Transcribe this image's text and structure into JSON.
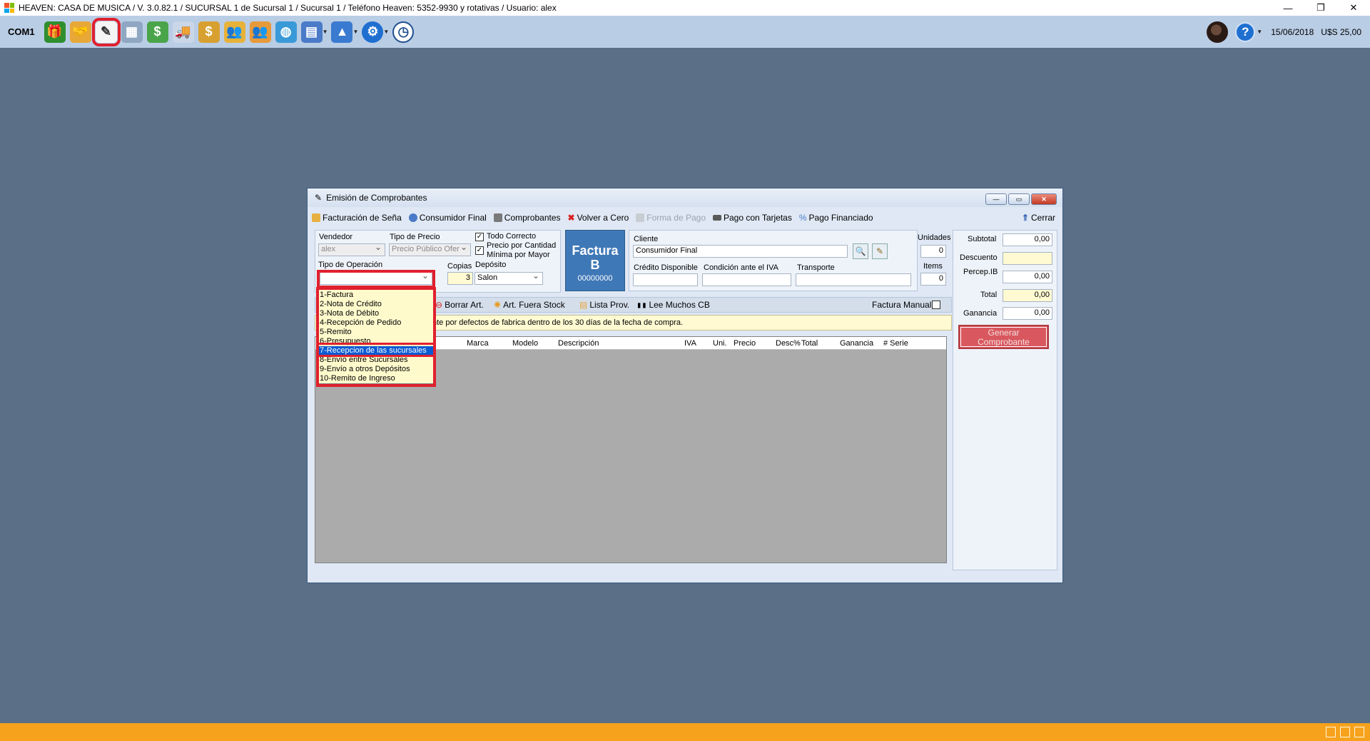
{
  "window": {
    "title": "HEAVEN: CASA DE MUSICA / V. 3.0.82.1 / SUCURSAL 1 de Sucursal 1 / Sucursal 1 / Teléfono Heaven: 5352-9930 y rotativas / Usuario: alex",
    "minimize": "—",
    "restore": "❐",
    "close": "✕"
  },
  "toolbar": {
    "port_label": "COM1",
    "date": "15/06/2018",
    "exchange_rate": "U$S 25,00",
    "help_symbol": "?",
    "icons": [
      "gift-icon",
      "handshake-icon",
      "invoice-icon",
      "calculator-icon",
      "money-icon",
      "delivery-truck-icon",
      "money-bag-icon",
      "users-icon",
      "groups-icon",
      "globe-icon",
      "book-icon",
      "chart-icon",
      "settings-gear-icon",
      "clock-icon"
    ],
    "selected_icon": "invoice-icon"
  },
  "dialog": {
    "title": "Emisión de Comprobantes",
    "menu": {
      "facturacion_sena": "Facturación de Seña",
      "consumidor_final": "Consumidor Final",
      "comprobantes": "Comprobantes",
      "volver_a_cero": "Volver a Cero",
      "forma_de_pago": "Forma de Pago",
      "pago_con_tarjetas": "Pago con Tarjetas",
      "pago_financiado": "Pago Financiado",
      "cerrar": "Cerrar"
    },
    "form": {
      "vendedor_label": "Vendedor",
      "vendedor_value": "alex",
      "tipo_precio_label": "Tipo de Precio",
      "tipo_precio_value": "Precio Público Ofer",
      "todo_correcto_label": "Todo Correcto",
      "todo_correcto_checked": true,
      "precio_cantidad_label": "Precio por Cantidad",
      "minima_mayor_label": "Mínima por Mayor",
      "precio_cantidad_checked": true,
      "tipo_operacion_label": "Tipo de Operación",
      "tipo_operacion_value": "",
      "copias_label": "Copias",
      "copias_value": "3",
      "deposito_label": "Depósito",
      "deposito_value": "Salon"
    },
    "factura": {
      "title_1": "Factura",
      "title_2": "B",
      "number": "00000000"
    },
    "cliente": {
      "cliente_label": "Cliente",
      "cliente_value": "Consumidor Final",
      "credito_label": "Crédito Disponible",
      "credito_value": "",
      "condicion_label": "Condición ante el IVA",
      "condicion_value": "",
      "transporte_label": "Transporte",
      "transporte_value": ""
    },
    "counts": {
      "unidades_label": "Unidades",
      "unidades_value": "0",
      "items_label": "Items",
      "items_value": "0"
    },
    "operation_options": [
      "1-Factura",
      "2-Nota de Crédito",
      "3-Nota de Débito",
      "4-Recepción de Pedido",
      "5-Remito",
      "6-Presupuesto",
      "7-Recepcion de las sucursales",
      "8-Envío entre Sucursales",
      "9-Envío a otros Depósitos",
      "10-Remito de Ingreso"
    ],
    "highlighted_option_index": 6,
    "article_toolbar": {
      "borrar": "Borrar Art.",
      "fuera_stock": "Art. Fuera Stock",
      "lista_prov": "Lista Prov.",
      "lee_muchos": "Lee Muchos CB",
      "factura_manual": "Factura Manual"
    },
    "info_text": "nte por defectos de fabrica dentro de los 30 días de la fecha de compra.",
    "grid_columns": {
      "marca": "Marca",
      "modelo": "Modelo",
      "descripcion": "Descripción",
      "iva": "IVA",
      "uni": "Uni.",
      "precio": "Precio",
      "desc": "Desc%",
      "total": "Total",
      "ganancia": "Ganancia",
      "serie": "# Serie"
    },
    "summary": {
      "subtotal_label": "Subtotal",
      "subtotal_value": "0,00",
      "descuento_label": "Descuento",
      "descuento_value": "",
      "percep_label": "Percep.IB",
      "percep_value": "0,00",
      "total_label": "Total",
      "total_value": "0,00",
      "ganancia_label": "Ganancia",
      "ganancia_value": "0,00",
      "generar_line1": "Generar",
      "generar_line2": "Comprobante"
    }
  }
}
